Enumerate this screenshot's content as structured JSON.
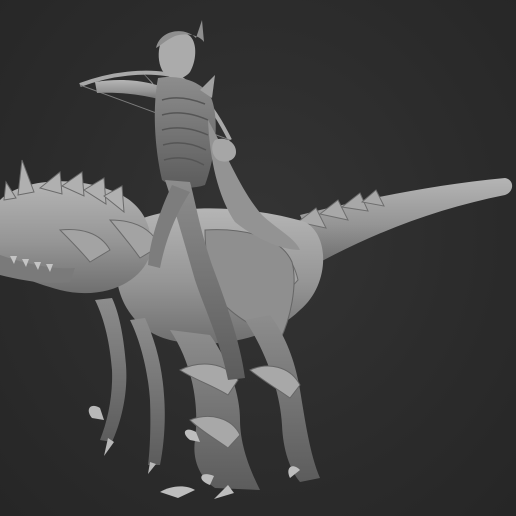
{
  "scene": {
    "background_color": "#2b2b2b",
    "model_color": "#9a9a9a",
    "subject": [
      "armored-raptor-icon",
      "elf-rider-icon",
      "longbow-icon"
    ]
  }
}
